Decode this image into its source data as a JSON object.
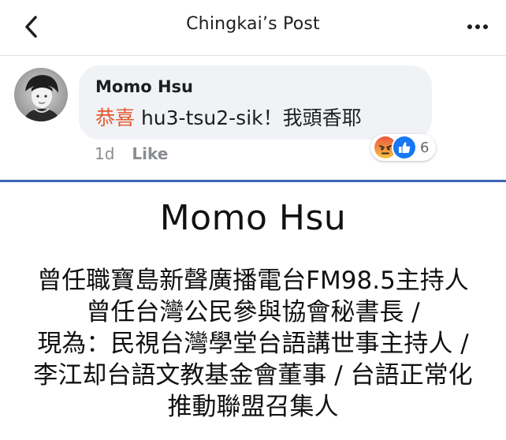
{
  "header": {
    "title": "Chingkai’s Post",
    "back_icon": "chevron-left-icon",
    "more_icon": "more-horizontal-icon"
  },
  "comment": {
    "author": "Momo Hsu",
    "text_highlight": "恭喜",
    "text_rest": " hu3-tsu2-sik！我頭香耶",
    "time": "1d",
    "like_label": "Like",
    "reactions": {
      "icons": [
        "angry-reaction-icon",
        "like-reaction-icon"
      ],
      "count": "6"
    }
  },
  "bio": {
    "name": "Momo Hsu",
    "lines": [
      "曾任職寶島新聲廣播電台FM98.5主持人",
      "曾任台灣公民參與協會秘書長 /",
      "現為：民視台灣學堂台語講世事主持人 /",
      "李江却台語文教基金會董事 / 台語正常化",
      "推動聯盟召集人"
    ]
  },
  "colors": {
    "highlight": "#e4572e",
    "divider": "#3f66b5",
    "bubble": "#f0f2f5",
    "like_blue": "#1877f2"
  }
}
